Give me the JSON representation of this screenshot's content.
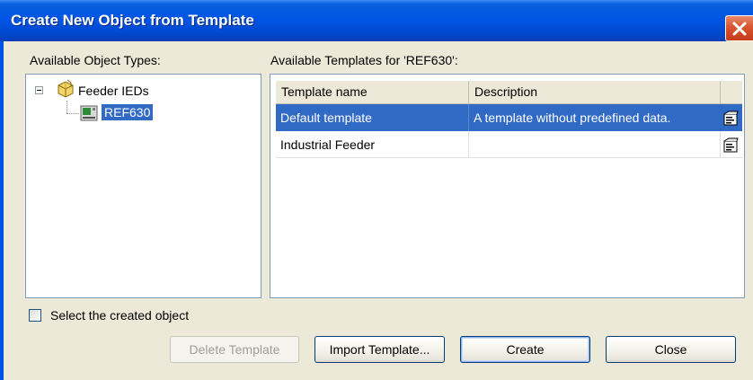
{
  "window": {
    "title": "Create New Object from Template",
    "close_icon": "close-icon",
    "colors": {
      "titlebar": "#0054e3",
      "close": "#d8552f",
      "selection": "#316ac5",
      "dialog_bg": "#ece9d8"
    }
  },
  "object_types": {
    "label": "Available Object Types:",
    "tree": {
      "root": {
        "label": "Feeder IEDs",
        "icon": "folder-package-icon",
        "expanded": true
      },
      "child": {
        "label": "REF630",
        "icon": "ied-device-icon",
        "selected": true
      }
    }
  },
  "templates": {
    "label": "Available Templates for 'REF630':",
    "columns": [
      "Template name",
      "Description",
      ""
    ],
    "rows": [
      {
        "name": "Default template",
        "description": "A template without predefined data.",
        "icon": "template-properties-icon",
        "selected": true
      },
      {
        "name": "Industrial Feeder",
        "description": "",
        "icon": "template-properties-icon",
        "selected": false
      }
    ]
  },
  "select_created": {
    "label": "Select the created object",
    "checked": false
  },
  "buttons": {
    "delete": "Delete Template",
    "import": "Import Template...",
    "create": "Create",
    "close": "Close"
  }
}
